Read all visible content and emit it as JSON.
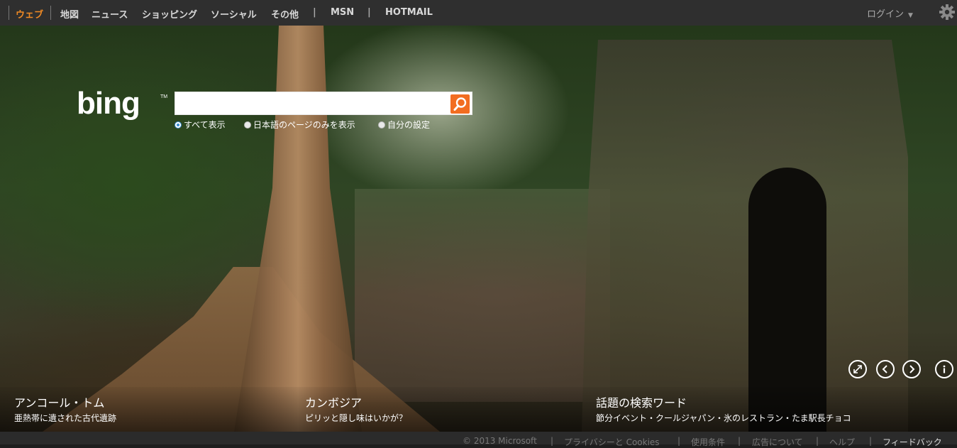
{
  "nav": {
    "items": [
      {
        "label": "ウェブ",
        "active": true
      },
      {
        "label": "地図"
      },
      {
        "label": "ニュース"
      },
      {
        "label": "ショッピング"
      },
      {
        "label": "ソーシャル"
      },
      {
        "label": "その他"
      }
    ],
    "msn": "MSN",
    "hotmail": "HOTMAIL",
    "pipe": "|",
    "login": "ログイン"
  },
  "logo": {
    "text": "bing"
  },
  "search": {
    "placeholder": "",
    "value": "",
    "scopes": [
      {
        "label": "すべて表示",
        "selected": true
      },
      {
        "label": "日本語のページのみを表示",
        "selected": false
      },
      {
        "label": "自分の設定",
        "selected": false
      }
    ]
  },
  "headlines": [
    {
      "title": "アンコール・トム",
      "subtitle": "亜熱帯に遺された古代遺跡"
    },
    {
      "title": "カンボジア",
      "subtitle": "ピリッと隠し味はいかが？"
    },
    {
      "title": "話題の検索ワード",
      "subtitle": "節分イベント・クールジャパン・氷のレストラン・たま駅長チョコ"
    }
  ],
  "controls": {
    "expand": "expand-icon",
    "prev": "chevron-left-icon",
    "next": "chevron-right-icon",
    "info": "info-icon"
  },
  "footer": {
    "copyright": "© 2013 Microsoft",
    "sep": "|",
    "privacy": "プライバシーと Cookies",
    "terms": "使用条件",
    "ads": "広告について",
    "help": "ヘルプ",
    "feedback": "フィードバック"
  },
  "colors": {
    "accent": "#f26d21",
    "nav_active": "#f08a24"
  }
}
